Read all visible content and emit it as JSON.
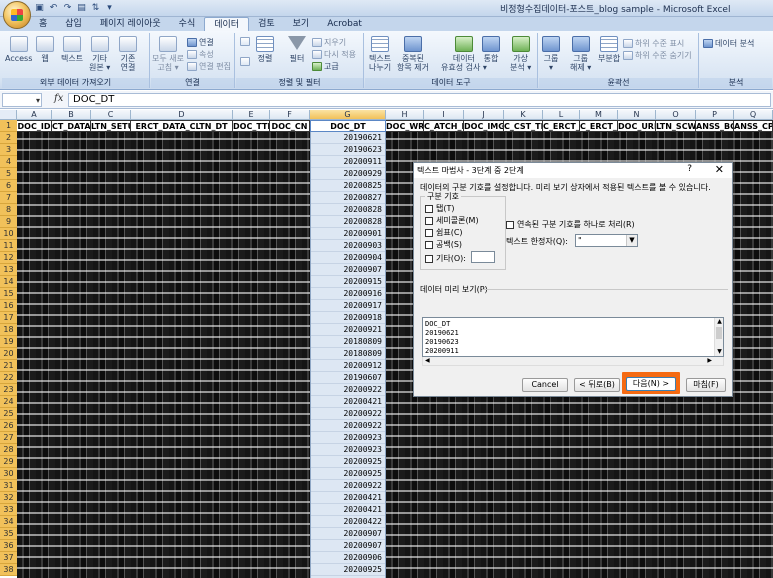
{
  "window": {
    "title": "비정형수집데이터-포스트_blog sample - Microsoft Excel"
  },
  "quick_access": [
    "save-icon",
    "undo-icon",
    "redo-icon",
    "print-preview-icon",
    "sort-icon",
    "customize-icon"
  ],
  "ribbon_tabs": [
    "홈",
    "삽입",
    "페이지 레이아웃",
    "수식",
    "데이터",
    "검토",
    "보기",
    "Acrobat"
  ],
  "active_tab": "데이터",
  "ribbon": {
    "external": {
      "label": "외부 데이터 가져오기",
      "access": "Access",
      "web": "웹",
      "text": "텍스트",
      "other_l1": "기타",
      "other_l2": "원본 ▾",
      "existing_l1": "기존",
      "existing_l2": "연결"
    },
    "connections": {
      "label": "연결",
      "refresh_l1": "모두 새로",
      "refresh_l2": "고침 ▾",
      "connections": "연결",
      "properties": "속성",
      "edit_links": "연결 편집"
    },
    "sort_filter": {
      "label": "정렬 및 필터",
      "sort": "정렬",
      "filter": "필터",
      "clear": "지우기",
      "reapply": "다시 적용",
      "advanced": "고급"
    },
    "data_tools": {
      "label": "데이터 도구",
      "text_to_cols_l1": "텍스트",
      "text_to_cols_l2": "나누기",
      "remove_dup_l1": "중복된",
      "remove_dup_l2": "항목 제거",
      "validation_l1": "데이터",
      "validation_l2": "유효성 검사 ▾",
      "consolidate": "통합",
      "whatif_l1": "가상",
      "whatif_l2": "분석 ▾"
    },
    "outline": {
      "label": "윤곽선",
      "group_l1": "그룹",
      "group_l2": "▾",
      "ungroup_l1": "그룹",
      "ungroup_l2": "해제 ▾",
      "subtotal": "부분합",
      "show_detail": "하위 수준 표시",
      "hide_detail": "하위 수준 숨기기"
    },
    "analysis": {
      "label": "분석",
      "data_analysis": "데이터 분석"
    }
  },
  "formula_bar": {
    "name_box": "",
    "fx": "fx",
    "content": "DOC_DT"
  },
  "sheet": {
    "column_letters": [
      "A",
      "B",
      "C",
      "D",
      "E",
      "F",
      "G",
      "H",
      "I",
      "J",
      "K",
      "L",
      "M",
      "N",
      "O",
      "P",
      "Q"
    ],
    "headers": [
      "DOC_ID",
      "CT_DATA_",
      "LTN_SETU_",
      "ERCT_DATA_CLTN_DT",
      "DOC_TTL",
      "DOC_CN",
      "DOC_DT",
      "DOC_WRTR",
      "C_ATCH_F",
      "DOC_IMG",
      "C_CST_TE",
      "C_ERCT_LI",
      "C_ERCT_HT",
      "DOC_URL",
      "LTN_SCW",
      "ANSS_BG",
      "ANSS_CPE"
    ],
    "row_numbers": [
      "1",
      "2",
      "3",
      "4",
      "5",
      "6",
      "7",
      "8",
      "9",
      "10",
      "11",
      "12",
      "13",
      "14",
      "15",
      "16",
      "17",
      "18",
      "19",
      "20",
      "21",
      "22",
      "23",
      "24",
      "25",
      "26",
      "27",
      "28",
      "29",
      "30",
      "31",
      "32",
      "33",
      "34",
      "35",
      "36",
      "37",
      "38"
    ],
    "doc_dt_values": [
      "20190621",
      "20190623",
      "20200911",
      "20200929",
      "20200825",
      "20200827",
      "20200828",
      "20200828",
      "20200901",
      "20200903",
      "20200904",
      "20200907",
      "20200915",
      "20200916",
      "20200917",
      "20200918",
      "20200921",
      "20180809",
      "20180809",
      "20200912",
      "20190607",
      "20200922",
      "20200421",
      "20200922",
      "20200922",
      "20200923",
      "20200923",
      "20200925",
      "20200925",
      "20200922",
      "20200421",
      "20200421",
      "20200422",
      "20200907",
      "20200907",
      "20200906",
      "20200925"
    ]
  },
  "dialog": {
    "title": "텍스트 마법사 - 3단계 중 2단계",
    "help": "?",
    "close": "✕",
    "description": "데이터의 구분 기호를 설정합니다. 미리 보기 상자에서 적용된 텍스트를 볼 수 있습니다.",
    "delimiters_legend": "구분 기호",
    "delimiters": [
      "탭(T)",
      "세미콜론(M)",
      "쉼표(C)",
      "공백(S)",
      "기타(O):"
    ],
    "consecutive": "연속된 구분 기호를 하나로 처리(R)",
    "qualifier_label": "텍스트 한정자(Q):",
    "qualifier_value": "\"",
    "preview_label": "데이터 미리 보기(P)",
    "preview_lines": [
      "DOC_DT",
      "20190621",
      "20190623",
      "20200911"
    ],
    "buttons": {
      "cancel": "Cancel",
      "back": "< 뒤로(B)",
      "next": "다음(N) >",
      "finish": "마침(F)"
    }
  },
  "colors": {
    "highlight": "#f56a12",
    "selected_header": "#f1c15a",
    "ribbon_bg": "#d9e5f3"
  }
}
